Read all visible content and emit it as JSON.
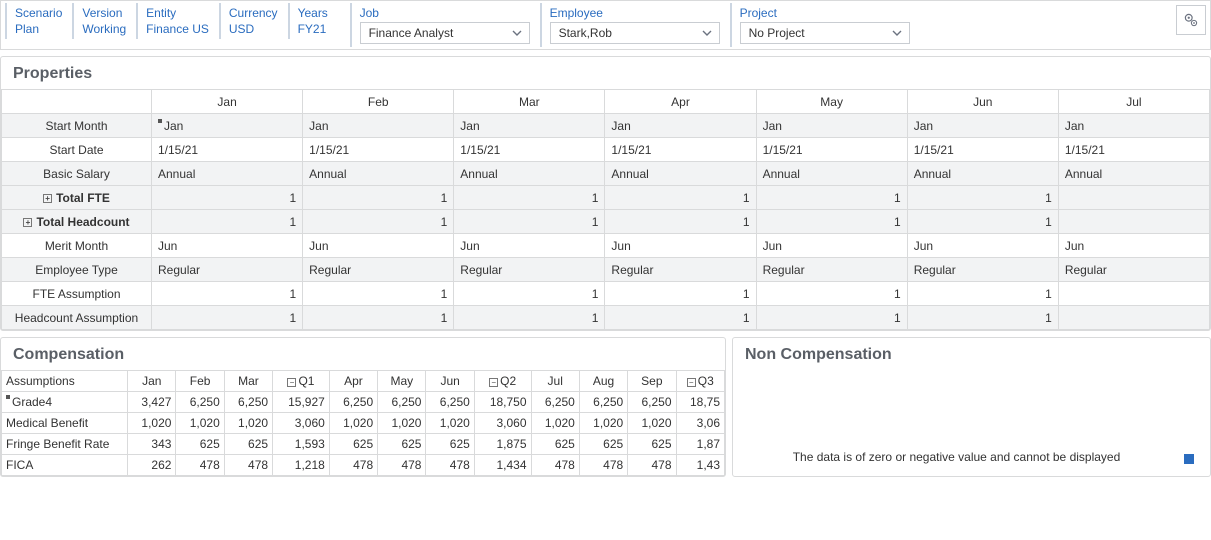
{
  "pov": {
    "scenario": {
      "label": "Scenario",
      "value": "Plan"
    },
    "version": {
      "label": "Version",
      "value": "Working"
    },
    "entity": {
      "label": "Entity",
      "value": "Finance US"
    },
    "currency": {
      "label": "Currency",
      "value": "USD"
    },
    "years": {
      "label": "Years",
      "value": "FY21"
    },
    "job": {
      "label": "Job",
      "value": "Finance Analyst"
    },
    "employee": {
      "label": "Employee",
      "value": "Stark,Rob"
    },
    "project": {
      "label": "Project",
      "value": "No Project"
    }
  },
  "propertiesTitle": "Properties",
  "months": [
    "Jan",
    "Feb",
    "Mar",
    "Apr",
    "May",
    "Jun",
    "Jul"
  ],
  "propRows": {
    "start_month": {
      "label": "Start Month",
      "values": [
        "Jan",
        "Jan",
        "Jan",
        "Jan",
        "Jan",
        "Jan",
        "Jan"
      ],
      "align": "txt",
      "marker": true
    },
    "start_date": {
      "label": "Start Date",
      "values": [
        "1/15/21",
        "1/15/21",
        "1/15/21",
        "1/15/21",
        "1/15/21",
        "1/15/21",
        "1/15/21"
      ],
      "align": "txt"
    },
    "basic_salary": {
      "label": "Basic Salary",
      "values": [
        "Annual",
        "Annual",
        "Annual",
        "Annual",
        "Annual",
        "Annual",
        "Annual"
      ],
      "align": "txt"
    },
    "total_fte": {
      "label": "Total FTE",
      "values": [
        "1",
        "1",
        "1",
        "1",
        "1",
        "1",
        ""
      ],
      "align": "num",
      "expand": true,
      "bold": true
    },
    "total_headcount": {
      "label": "Total Headcount",
      "values": [
        "1",
        "1",
        "1",
        "1",
        "1",
        "1",
        ""
      ],
      "align": "num",
      "expand": true,
      "bold": true
    },
    "merit_month": {
      "label": "Merit Month",
      "values": [
        "Jun",
        "Jun",
        "Jun",
        "Jun",
        "Jun",
        "Jun",
        "Jun"
      ],
      "align": "txt"
    },
    "employee_type": {
      "label": "Employee Type",
      "values": [
        "Regular",
        "Regular",
        "Regular",
        "Regular",
        "Regular",
        "Regular",
        "Regular"
      ],
      "align": "txt"
    },
    "fte_assumption": {
      "label": "FTE Assumption",
      "values": [
        "1",
        "1",
        "1",
        "1",
        "1",
        "1",
        ""
      ],
      "align": "num"
    },
    "headcount_assumption": {
      "label": "Headcount Assumption",
      "values": [
        "1",
        "1",
        "1",
        "1",
        "1",
        "1",
        ""
      ],
      "align": "num"
    }
  },
  "compTitle": "Compensation",
  "compAssumptionsLabel": "Assumptions",
  "compCols": [
    "Jan",
    "Feb",
    "Mar",
    "Q1",
    "Apr",
    "May",
    "Jun",
    "Q2",
    "Jul",
    "Aug",
    "Sep",
    "Q3"
  ],
  "compColCollapse": [
    false,
    false,
    false,
    true,
    false,
    false,
    false,
    true,
    false,
    false,
    false,
    true
  ],
  "compRows": [
    {
      "label": "Grade4",
      "marker": true,
      "values": [
        "3,427",
        "6,250",
        "6,250",
        "15,927",
        "6,250",
        "6,250",
        "6,250",
        "18,750",
        "6,250",
        "6,250",
        "6,250",
        "18,75"
      ]
    },
    {
      "label": "Medical Benefit",
      "values": [
        "1,020",
        "1,020",
        "1,020",
        "3,060",
        "1,020",
        "1,020",
        "1,020",
        "3,060",
        "1,020",
        "1,020",
        "1,020",
        "3,06"
      ]
    },
    {
      "label": "Fringe Benefit Rate",
      "values": [
        "343",
        "625",
        "625",
        "1,593",
        "625",
        "625",
        "625",
        "1,875",
        "625",
        "625",
        "625",
        "1,87"
      ]
    },
    {
      "label": "FICA",
      "values": [
        "262",
        "478",
        "478",
        "1,218",
        "478",
        "478",
        "478",
        "1,434",
        "478",
        "478",
        "478",
        "1,43"
      ]
    }
  ],
  "nonCompTitle": "Non Compensation",
  "nonCompMsg": "The data is of zero or negative value and cannot be displayed"
}
